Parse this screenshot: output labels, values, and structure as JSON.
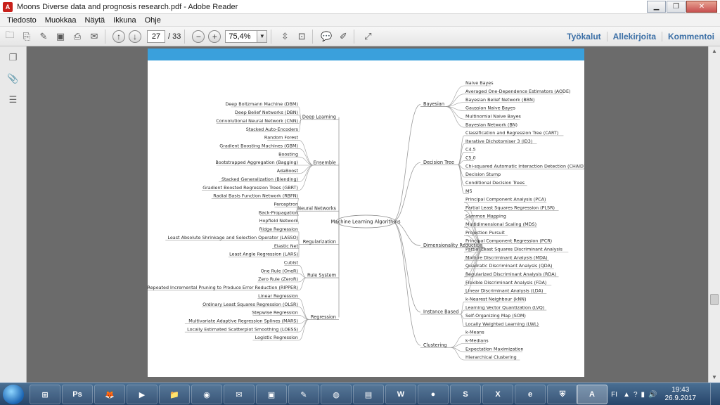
{
  "window": {
    "title": "Moons Diverse data and prognosis research.pdf - Adobe Reader",
    "minimize": "▁",
    "maximize": "❐",
    "close": "✕"
  },
  "menu": [
    "Tiedosto",
    "Muokkaa",
    "Näytä",
    "Ikkuna",
    "Ohje"
  ],
  "toolbar": {
    "page_current": "27",
    "page_total": "/ 33",
    "zoom": "75,4%",
    "links": [
      "Työkalut",
      "Allekirjoita",
      "Kommentoi"
    ]
  },
  "mindmap": {
    "center": "Machine Learning Algorithms",
    "left": [
      {
        "label": "Deep Learning",
        "items": [
          "Deep Boltzmann Machine (DBM)",
          "Deep Belief Networks (DBN)",
          "Convolutional Neural Network (CNN)",
          "Stacked Auto-Encoders"
        ]
      },
      {
        "label": "Ensemble",
        "items": [
          "Random Forest",
          "Gradient Boosting Machines (GBM)",
          "Boosting",
          "Bootstrapped Aggregation (Bagging)",
          "AdaBoost",
          "Stacked Generalization (Blending)",
          "Gradient Boosted Regression Trees (GBRT)"
        ]
      },
      {
        "label": "Neural Networks",
        "items": [
          "Radial Basis Function Network (RBFN)",
          "Perceptron",
          "Back-Propagation",
          "Hopfield Network"
        ]
      },
      {
        "label": "Regularization",
        "items": [
          "Ridge Regression",
          "Least Absolute Shrinkage and Selection Operator (LASSO)",
          "Elastic Net",
          "Least Angle Regression (LARS)"
        ]
      },
      {
        "label": "Rule System",
        "items": [
          "Cubist",
          "One Rule (OneR)",
          "Zero Rule (ZeroR)",
          "Repeated Incremental Pruning to Produce Error Reduction (RIPPER)"
        ]
      },
      {
        "label": "Regression",
        "items": [
          "Linear Regression",
          "Ordinary Least Squares Regression (OLSR)",
          "Stepwise Regression",
          "Multivariate Adaptive Regression Splines (MARS)",
          "Locally Estimated Scatterplot Smoothing (LOESS)",
          "Logistic Regression"
        ]
      }
    ],
    "right": [
      {
        "label": "Bayesian",
        "items": [
          "Naive Bayes",
          "Averaged One-Dependence Estimators (AODE)",
          "Bayesian Belief Network (BBN)",
          "Gaussian Naive Bayes",
          "Multinomial Naive Bayes",
          "Bayesian Network (BN)"
        ]
      },
      {
        "label": "Decision Tree",
        "items": [
          "Classification and Regression Tree (CART)",
          "Iterative Dichotomiser 3 (ID3)",
          "C4.5",
          "C5.0",
          "Chi-squared Automatic Interaction Detection (CHAID)",
          "Decision Stump",
          "Conditional Decision Trees",
          "M5"
        ]
      },
      {
        "label": "Dimensionality Reduction",
        "items": [
          "Principal Component Analysis (PCA)",
          "Partial Least Squares Regression (PLSR)",
          "Sammon Mapping",
          "Multidimensional Scaling (MDS)",
          "Projection Pursuit",
          "Principal Component Regression (PCR)",
          "Partial Least Squares Discriminant Analysis",
          "Mixture Discriminant Analysis (MDA)",
          "Quadratic Discriminant Analysis (QDA)",
          "Regularized Discriminant Analysis (RDA)",
          "Flexible Discriminant Analysis (FDA)",
          "Linear Discriminant Analysis (LDA)"
        ]
      },
      {
        "label": "Instance Based",
        "items": [
          "k-Nearest Neighbour (kNN)",
          "Learning Vector Quantization (LVQ)",
          "Self-Organizing Map (SOM)",
          "Locally Weighted Learning (LWL)"
        ]
      },
      {
        "label": "Clustering",
        "items": [
          "k-Means",
          "k-Medians",
          "Expectation Maximization",
          "Hierarchical Clustering"
        ]
      }
    ]
  },
  "taskbar": {
    "apps": [
      "⊞",
      "Ps",
      "🦊",
      "▶",
      "📁",
      "◉",
      "✉",
      "▣",
      "✎",
      "◍",
      "▤",
      "W",
      "●",
      "S",
      "X",
      "e",
      "⛨",
      "A"
    ],
    "lang": "FI",
    "time": "19:43",
    "date": "26.9.2017"
  }
}
